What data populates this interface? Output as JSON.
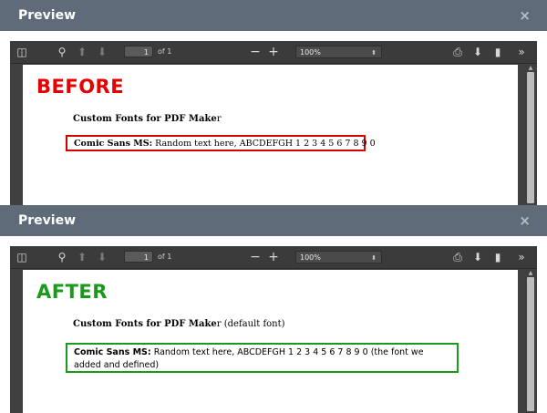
{
  "panels": [
    {
      "header": {
        "title": "Preview",
        "close_icon": "×"
      },
      "toolbar": {
        "page_current": "1",
        "page_total": "of 1",
        "zoom": "100%"
      },
      "document": {
        "badge": "BEFORE",
        "title_main": "Custom Fonts for PDF Make",
        "title_tail": "r",
        "title_note": "",
        "sample_label": "Comic Sans MS:",
        "sample_text": " Random text here, ABCDEFGH 1 2 3 4 5 6 7 8 9 0",
        "sample_note": ""
      }
    },
    {
      "header": {
        "title": "Preview",
        "close_icon": "×"
      },
      "toolbar": {
        "page_current": "1",
        "page_total": "of 1",
        "zoom": "100%"
      },
      "document": {
        "badge": "AFTER",
        "title_main": "Custom Fonts for PDF Make",
        "title_tail": "r",
        "title_note": " (default font)",
        "sample_label": "Comic Sans MS:",
        "sample_text": " Random text here, ABCDEFGH 1 2 3 4 5 6 7 8 9 0",
        "sample_note": " (the font we added and defined)"
      }
    }
  ],
  "colors": {
    "header_bg": "#5f6b78",
    "before": "#e60000",
    "after": "#1a9a1a",
    "viewer_bg": "#404040"
  }
}
